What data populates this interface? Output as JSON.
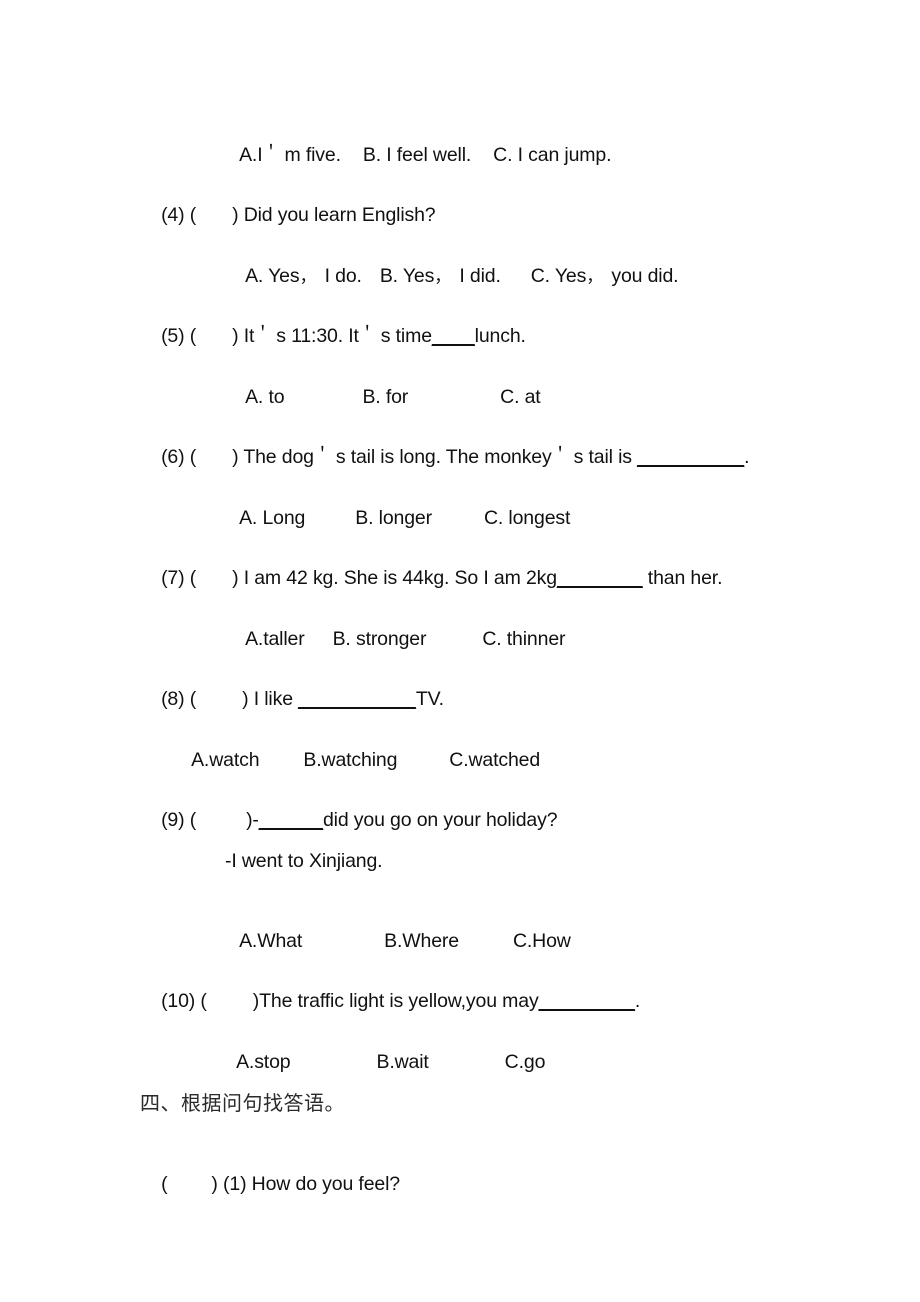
{
  "document": {
    "type": "worksheet-page",
    "language": "en-zh",
    "background_color": "#ffffff",
    "text_color": "#111111"
  },
  "lines": {
    "q3_options": {
      "a": "A.I",
      "a_rest": "m five.",
      "b": "B. I feel well.",
      "c": "C. I can jump."
    },
    "q4": {
      "number": "(4) (",
      "close": ") Did you learn English?",
      "a_pre": "A. Yes",
      "a_post": " I do.",
      "b_pre": "B. Yes",
      "b_post": " I did.",
      "c_pre": "C. Yes",
      "c_post": " you did."
    },
    "q5": {
      "number": "(5) (",
      "p1": ") It",
      "p2": "s 11:30. It",
      "p3": "s time",
      "blank": "____",
      "p4": "lunch.",
      "a": "A. to",
      "b": "B. for",
      "c": "C. at"
    },
    "q6": {
      "number": "(6) (",
      "p1": ") The dog",
      "p2": "s tail is long. The monkey",
      "p3": "s tail is ",
      "blank": "__________",
      "p4": ".",
      "a": "A. Long",
      "b": "B. longer",
      "c": "C. longest"
    },
    "q7": {
      "number": "(7) (",
      "p1": ") I am 42 kg. She is 44kg. So I am 2kg",
      "blank": "________",
      "p2": " than her.",
      "a": "A.taller",
      "b": "B. stronger",
      "c": "C. thinner"
    },
    "q8": {
      "number": "(8) (",
      "p1": ") I like ",
      "blank": "___________",
      "p2": "TV.",
      "a": "A.watch",
      "b": "B.watching",
      "c": "C.watched"
    },
    "q9": {
      "number": "(9) (",
      "p1": ")-",
      "blank": "______",
      "p2": "did you go on your holiday?",
      "answer": "-I went to Xinjiang.",
      "a": "A.What",
      "b": "B.Where",
      "c": "C.How"
    },
    "q10": {
      "number": "(10) (",
      "p1": ")The traffic light is yellow,you may",
      "blank": "_________",
      "p2": ".",
      "a": "A.stop",
      "b": "B.wait",
      "c": "C.go"
    },
    "section_four": {
      "heading": "四、根据问句找答语。",
      "item1_bracket": "(",
      "item1_text": ") (1) How do you feel?"
    }
  },
  "glyphs": {
    "apostrophe": "＇",
    "fullwidth_comma": "，"
  }
}
